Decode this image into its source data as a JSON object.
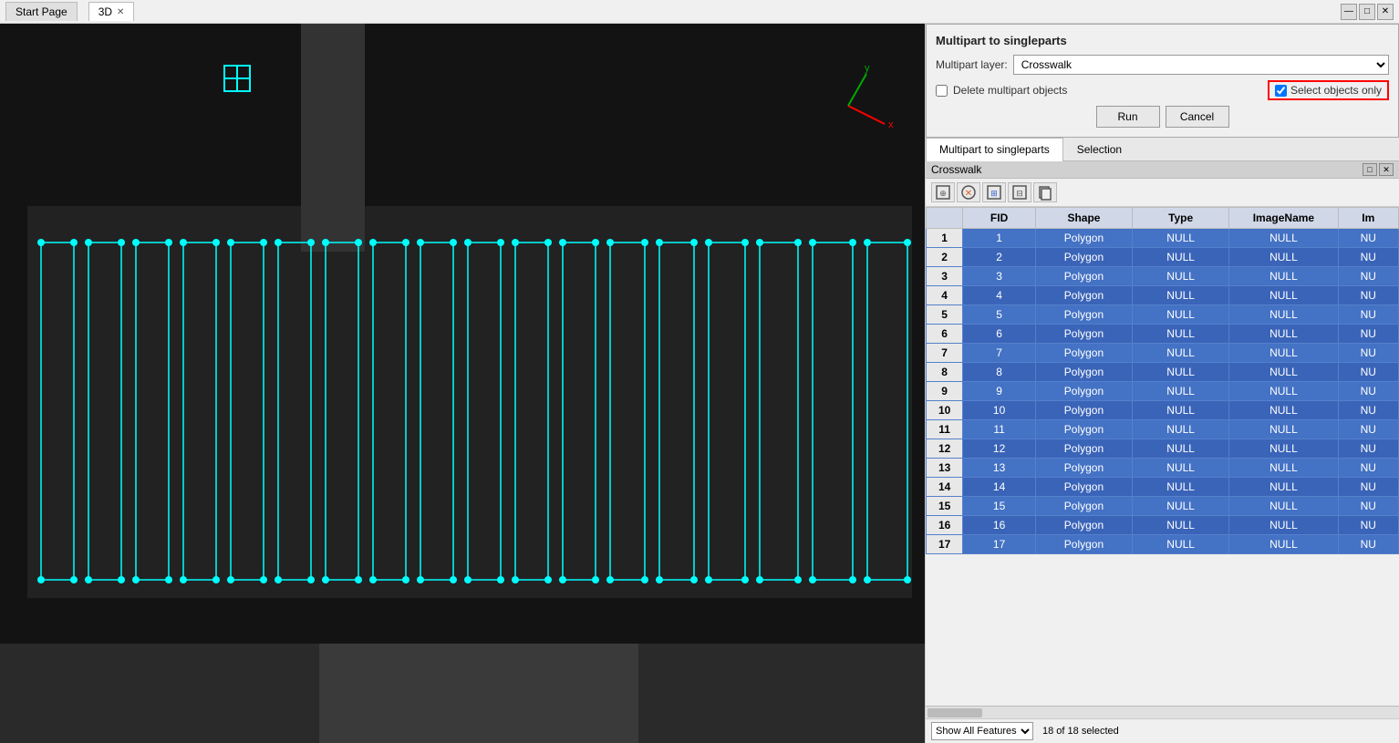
{
  "topbar": {
    "tabs": [
      {
        "label": "Start Page",
        "active": false
      },
      {
        "label": "3D",
        "active": true,
        "closeable": true
      }
    ],
    "win_controls": [
      "—",
      "□",
      "✕"
    ]
  },
  "dialog": {
    "title": "Multipart to singleparts",
    "layer_label": "Multipart layer:",
    "layer_value": "Crosswalk",
    "delete_label": "Delete multipart objects",
    "delete_checked": false,
    "select_objects_label": "Select objects only",
    "select_objects_checked": true,
    "buttons": [
      "Run",
      "Cancel"
    ]
  },
  "panel_tabs": [
    "Multipart to singleparts",
    "Selection"
  ],
  "attr_table": {
    "title": "Crosswalk",
    "win_btns": [
      "□",
      "✕"
    ],
    "toolbar_icons": [
      "⊕",
      "⊗",
      "⊞",
      "⊟",
      "⊠"
    ],
    "columns": [
      "",
      "FID",
      "Shape",
      "Type",
      "ImageName",
      "Im"
    ],
    "rows": [
      {
        "row": 1,
        "fid": 1,
        "shape": "Polygon",
        "type": "NULL",
        "imagename": "NULL",
        "im": "NU"
      },
      {
        "row": 2,
        "fid": 2,
        "shape": "Polygon",
        "type": "NULL",
        "imagename": "NULL",
        "im": "NU"
      },
      {
        "row": 3,
        "fid": 3,
        "shape": "Polygon",
        "type": "NULL",
        "imagename": "NULL",
        "im": "NU"
      },
      {
        "row": 4,
        "fid": 4,
        "shape": "Polygon",
        "type": "NULL",
        "imagename": "NULL",
        "im": "NU"
      },
      {
        "row": 5,
        "fid": 5,
        "shape": "Polygon",
        "type": "NULL",
        "imagename": "NULL",
        "im": "NU"
      },
      {
        "row": 6,
        "fid": 6,
        "shape": "Polygon",
        "type": "NULL",
        "imagename": "NULL",
        "im": "NU"
      },
      {
        "row": 7,
        "fid": 7,
        "shape": "Polygon",
        "type": "NULL",
        "imagename": "NULL",
        "im": "NU"
      },
      {
        "row": 8,
        "fid": 8,
        "shape": "Polygon",
        "type": "NULL",
        "imagename": "NULL",
        "im": "NU"
      },
      {
        "row": 9,
        "fid": 9,
        "shape": "Polygon",
        "type": "NULL",
        "imagename": "NULL",
        "im": "NU"
      },
      {
        "row": 10,
        "fid": 10,
        "shape": "Polygon",
        "type": "NULL",
        "imagename": "NULL",
        "im": "NU"
      },
      {
        "row": 11,
        "fid": 11,
        "shape": "Polygon",
        "type": "NULL",
        "imagename": "NULL",
        "im": "NU"
      },
      {
        "row": 12,
        "fid": 12,
        "shape": "Polygon",
        "type": "NULL",
        "imagename": "NULL",
        "im": "NU"
      },
      {
        "row": 13,
        "fid": 13,
        "shape": "Polygon",
        "type": "NULL",
        "imagename": "NULL",
        "im": "NU"
      },
      {
        "row": 14,
        "fid": 14,
        "shape": "Polygon",
        "type": "NULL",
        "imagename": "NULL",
        "im": "NU"
      },
      {
        "row": 15,
        "fid": 15,
        "shape": "Polygon",
        "type": "NULL",
        "imagename": "NULL",
        "im": "NU"
      },
      {
        "row": 16,
        "fid": 16,
        "shape": "Polygon",
        "type": "NULL",
        "imagename": "NULL",
        "im": "NU"
      },
      {
        "row": 17,
        "fid": 17,
        "shape": "Polygon",
        "type": "NULL",
        "imagename": "NULL",
        "im": "NU"
      }
    ]
  },
  "status_bar": {
    "filter_label": "Show All Features",
    "selection_info": "18 of 18 selected"
  },
  "colors": {
    "cyan": "#00ffff",
    "row_bg": "#4472c4",
    "selected_border": "red"
  }
}
